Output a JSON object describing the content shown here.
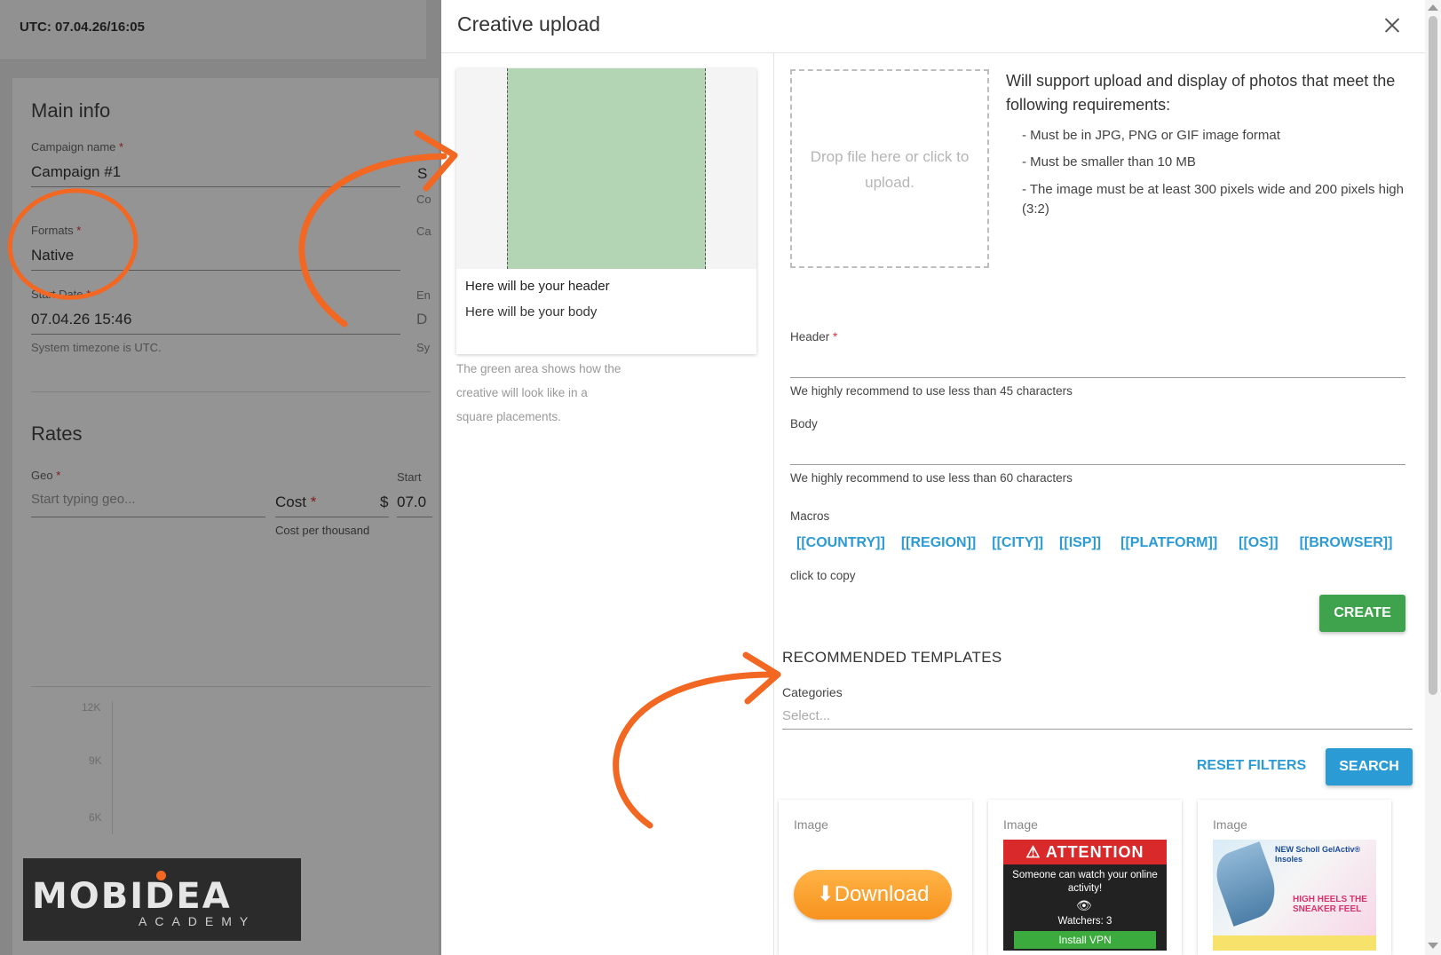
{
  "background": {
    "utc": "UTC: 07.04.26/16:05",
    "main_info": {
      "title": "Main info",
      "campaign_name_label": "Campaign name",
      "campaign_name_value": "Campaign #1",
      "formats_label": "Formats",
      "formats_value": "Native",
      "start_date_label": "Start Date",
      "start_date_value": "07.04.26 15:46",
      "timezone_hint": "System timezone is UTC.",
      "col2_snippets": [
        "S",
        "Co",
        "Ca",
        "En",
        "D",
        "Sy"
      ]
    },
    "rates": {
      "title": "Rates",
      "geo_label": "Geo",
      "geo_placeholder": "Start typing geo...",
      "cost_label": "Cost",
      "currency": "$",
      "cost_hint": "Cost per thousand",
      "start_label": "Start",
      "start_value": "07.0"
    },
    "chart_ticks": [
      "12K",
      "9K",
      "6K"
    ],
    "required_mark": "*"
  },
  "logo": {
    "main": "MOBIDEA",
    "sub": "ACADEMY"
  },
  "modal": {
    "title": "Creative upload",
    "preview": {
      "header": "Here will be your header",
      "body": "Here will be your body",
      "note": "The green area shows how the creative will look like in a square placements."
    },
    "dropzone_text": "Drop file here or click to upload.",
    "requirements": {
      "title": "Will support upload and display of photos that meet the following requirements:",
      "items": [
        "- Must be in JPG, PNG or GIF image format",
        "- Must be smaller than 10 MB",
        "- The image must be at least 300 pixels wide and 200 pixels high (3:2)"
      ]
    },
    "header_label": "Header",
    "header_hint": "We highly recommend to use less than 45 characters",
    "body_label": "Body",
    "body_hint": "We highly recommend to use less than 60 characters",
    "macros_label": "Macros",
    "macros": [
      "[[COUNTRY]]",
      "[[REGION]]",
      "[[CITY]]",
      "[[ISP]]",
      "[[PLATFORM]]",
      "[[OS]]",
      "[[BROWSER]]"
    ],
    "macros_hint": "click to copy",
    "create_label": "CREATE",
    "recommended_title": "RECOMMENDED TEMPLATES",
    "categories_label": "Categories",
    "categories_placeholder": "Select...",
    "reset_label": "RESET FILTERS",
    "search_label": "SEARCH",
    "templates": [
      {
        "label": "Image",
        "download_text": "⬇Download"
      },
      {
        "label": "Image",
        "attention": "ATTENTION",
        "message": "Someone can watch your online activity!",
        "watchers": "Watchers: 3",
        "button": "Install VPN"
      },
      {
        "label": "Image",
        "brand": "NEW Scholl GelActiv® Insoles",
        "tagline": "HIGH HEELS THE SNEAKER FEEL"
      }
    ]
  },
  "colors": {
    "accent_blue": "#2b9bd6",
    "create_green": "#3fa34d",
    "annotation_orange": "#f26722"
  }
}
